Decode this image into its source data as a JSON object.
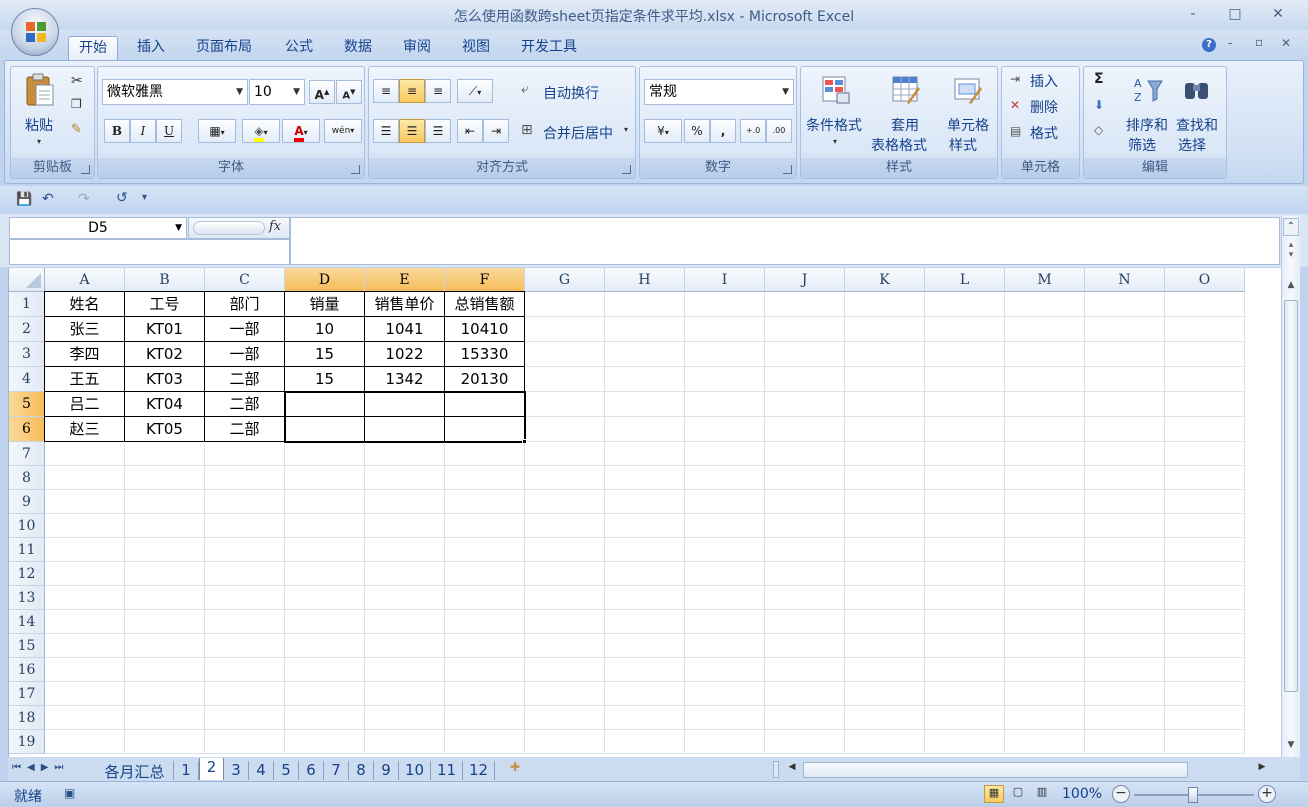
{
  "window": {
    "title": "怎么使用函数跨sheet页指定条件求平均.xlsx - Microsoft Excel",
    "minimize": "-",
    "maximize": "□",
    "close": "✕"
  },
  "ribbon_tabs": [
    "开始",
    "插入",
    "页面布局",
    "公式",
    "数据",
    "审阅",
    "视图",
    "开发工具"
  ],
  "ribbon_right": {
    "help": "?",
    "min": "-",
    "restore": "▫",
    "close": "✕"
  },
  "groups": {
    "clipboard": {
      "label": "剪贴板",
      "paste": "粘贴"
    },
    "font": {
      "label": "字体",
      "font_name": "微软雅黑",
      "font_size": "10",
      "bold": "B",
      "italic": "I",
      "underline": "U",
      "grow": "A",
      "shrink": "A",
      "font_color_letter": "A",
      "phonetic": "wén"
    },
    "alignment": {
      "label": "对齐方式",
      "wrap": "自动换行",
      "merge": "合并后居中"
    },
    "number": {
      "label": "数字",
      "format": "常规",
      "percent": "%",
      "comma": ",",
      "inc_dec": "+.0",
      "dec_dec": ".00"
    },
    "styles": {
      "label": "样式",
      "cond": "条件格式",
      "table1": "套用",
      "table2": "表格格式",
      "cell1": "单元格",
      "cell2": "样式"
    },
    "cells": {
      "label": "单元格",
      "insert": "插入",
      "delete": "删除",
      "format": "格式"
    },
    "editing": {
      "label": "编辑",
      "sum": "Σ",
      "sort1": "排序和",
      "sort2": "筛选",
      "find1": "查找和",
      "find2": "选择"
    }
  },
  "name_box": "D5",
  "fx": "fx",
  "formula": "",
  "columns": [
    "A",
    "B",
    "C",
    "D",
    "E",
    "F",
    "G",
    "H",
    "I",
    "J",
    "K",
    "L",
    "M",
    "N",
    "O"
  ],
  "selected_columns": [
    "D",
    "E",
    "F"
  ],
  "rows": [
    "1",
    "2",
    "3",
    "4",
    "5",
    "6",
    "7",
    "8",
    "9",
    "10",
    "11",
    "12",
    "13",
    "14",
    "15",
    "16",
    "17",
    "18",
    "19"
  ],
  "selected_rows": [
    "5",
    "6"
  ],
  "table": {
    "header": [
      "姓名",
      "工号",
      "部门",
      "销量",
      "销售单价",
      "总销售额"
    ],
    "rows": [
      [
        "张三",
        "KT01",
        "一部",
        "10",
        "1041",
        "10410"
      ],
      [
        "李四",
        "KT02",
        "一部",
        "15",
        "1022",
        "15330"
      ],
      [
        "王五",
        "KT03",
        "二部",
        "15",
        "1342",
        "20130"
      ],
      [
        "吕二",
        "KT04",
        "二部",
        "",
        "",
        ""
      ],
      [
        "赵三",
        "KT05",
        "二部",
        "",
        "",
        ""
      ]
    ]
  },
  "sheet_tabs": [
    "各月汇总",
    "1",
    "2",
    "3",
    "4",
    "5",
    "6",
    "7",
    "8",
    "9",
    "10",
    "11",
    "12"
  ],
  "active_sheet": "2",
  "status": {
    "mode": "就绪",
    "zoom": "100%"
  },
  "colors": {
    "selection_header": "#f6bc5b",
    "ribbon_bg": "#d3e1f4",
    "accent": "#15428b"
  }
}
